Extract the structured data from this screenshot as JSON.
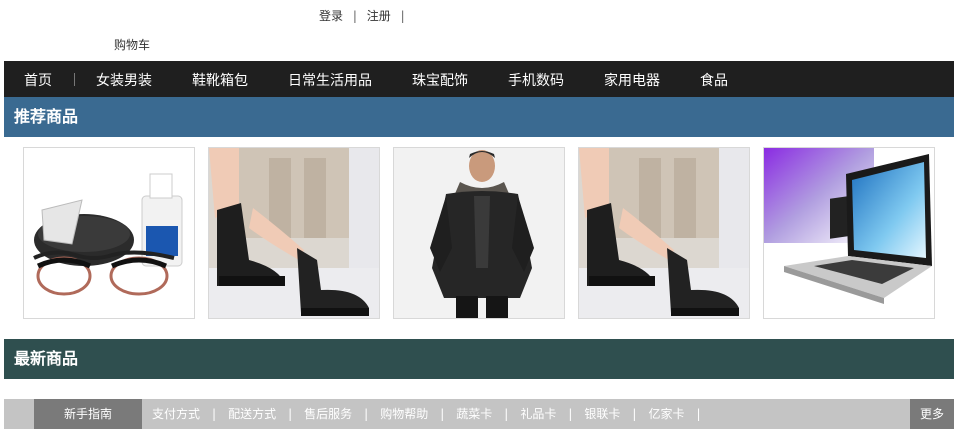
{
  "header": {
    "login_label": "登录",
    "register_label": "注册",
    "separator": "|",
    "cart_label": "购物车"
  },
  "nav": {
    "items": [
      "首页",
      "女装男装",
      "鞋靴箱包",
      "日常生活用品",
      "珠宝配饰",
      "手机数码",
      "家用电器",
      "食品"
    ]
  },
  "recommended": {
    "title": "推荐商品",
    "products": [
      {
        "image": "glasses-and-lens-cleaner-icon"
      },
      {
        "image": "black-ankle-boots-icon"
      },
      {
        "image": "mens-black-jacket-icon"
      },
      {
        "image": "black-ankle-boots-icon"
      },
      {
        "image": "laptop-icon"
      }
    ]
  },
  "latest": {
    "title": "最新商品"
  },
  "footer": {
    "active_label": "新手指南",
    "links": [
      "支付方式",
      "配送方式",
      "售后服务",
      "购物帮助",
      "蔬菜卡",
      "礼品卡",
      "银联卡",
      "亿家卡"
    ],
    "more_label": "更多"
  }
}
